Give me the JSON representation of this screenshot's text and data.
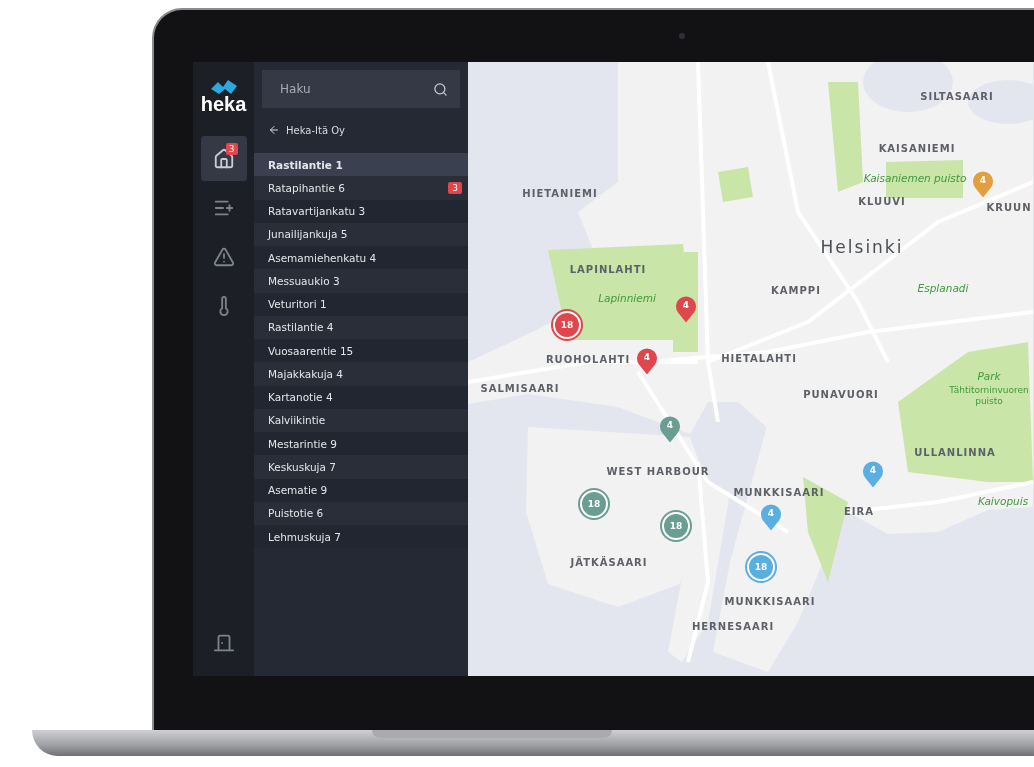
{
  "sidebar": {
    "logo": "heka",
    "nav": [
      {
        "selected": true,
        "badge": "3"
      },
      {
        "selected": false
      },
      {
        "selected": false
      },
      {
        "selected": false
      }
    ]
  },
  "panel": {
    "search": {
      "placeholder": "Haku"
    },
    "back": "Heka-Itä Oy",
    "items": [
      {
        "label": "Rastilantie 1",
        "selected": true
      },
      {
        "label": "Ratapihantie 6",
        "selected": false,
        "badge": "3"
      },
      {
        "label": "Ratavartijankatu 3",
        "selected": false
      },
      {
        "label": "Junailijankuja 5",
        "selected": false
      },
      {
        "label": "Asemamiehenkatu 4",
        "selected": false
      },
      {
        "label": "Messuaukio 3",
        "selected": false
      },
      {
        "label": "Veturitori 1",
        "selected": false
      },
      {
        "label": "Rastilantie 4",
        "selected": false
      },
      {
        "label": "Vuosaarentie 15",
        "selected": false
      },
      {
        "label": "Majakkakuja 4",
        "selected": false
      },
      {
        "label": "Kartanotie 4",
        "selected": false
      },
      {
        "label": "Kalviikintie",
        "selected": false
      },
      {
        "label": "Mestarintie 9",
        "selected": false
      },
      {
        "label": "Keskuskuja 7",
        "selected": false
      },
      {
        "label": "Asematie 9",
        "selected": false
      },
      {
        "label": "Puistotie 6",
        "selected": false
      },
      {
        "label": "Lehmuskuja 7",
        "selected": false
      }
    ]
  },
  "map": {
    "labels": [
      {
        "text": "SILTASAARI",
        "kind": "district"
      },
      {
        "text": "KAISANIEMI",
        "kind": "district"
      },
      {
        "text": "Kaisaniemen puisto",
        "kind": "park"
      },
      {
        "text": "KLUUVI",
        "kind": "district"
      },
      {
        "text": "KRUUN",
        "kind": "district"
      },
      {
        "text": "HIETANIEMI",
        "kind": "district"
      },
      {
        "text": "Helsinki",
        "kind": "city"
      },
      {
        "text": "LAPINLAHTI",
        "kind": "district"
      },
      {
        "text": "Lapinniemi",
        "kind": "park"
      },
      {
        "text": "KAMPPI",
        "kind": "district"
      },
      {
        "text": "Esplanadi",
        "kind": "park"
      },
      {
        "text": "RUOHOLAHTI",
        "kind": "district"
      },
      {
        "text": "HIETALAHTI",
        "kind": "district"
      },
      {
        "text": "SALMISAARI",
        "kind": "district"
      },
      {
        "text": "PUNAVUORI",
        "kind": "district"
      },
      {
        "text": "Park",
        "kind": "park"
      },
      {
        "text": "Tähtitorninvuoren puisto",
        "kind": "park-small"
      },
      {
        "text": "ULLANLINNA",
        "kind": "district"
      },
      {
        "text": "WEST HARBOUR",
        "kind": "district"
      },
      {
        "text": "MUNKKISAARI",
        "kind": "district"
      },
      {
        "text": "EIRA",
        "kind": "district"
      },
      {
        "text": "Kaivopuis",
        "kind": "park"
      },
      {
        "text": "JÄTKÄSAARI",
        "kind": "district"
      },
      {
        "text": "MUNKKISAARI",
        "kind": "district"
      },
      {
        "text": "HERNESAARI",
        "kind": "district"
      }
    ],
    "markers": [
      {
        "kind": "cluster",
        "count": "18",
        "color": "#e0474c"
      },
      {
        "kind": "pin",
        "count": "4",
        "color": "#e0474c"
      },
      {
        "kind": "pin",
        "count": "4",
        "color": "#e0474c"
      },
      {
        "kind": "pin",
        "count": "4",
        "color": "#6a9e92"
      },
      {
        "kind": "cluster",
        "count": "18",
        "color": "#6a9e92"
      },
      {
        "kind": "cluster",
        "count": "18",
        "color": "#6a9e92"
      },
      {
        "kind": "pin",
        "count": "4",
        "color": "#5aaee0"
      },
      {
        "kind": "cluster",
        "count": "18",
        "color": "#5aaee0"
      },
      {
        "kind": "pin",
        "count": "4",
        "color": "#5aaee0"
      },
      {
        "kind": "pin",
        "count": "4",
        "color": "#e0a040"
      }
    ]
  }
}
